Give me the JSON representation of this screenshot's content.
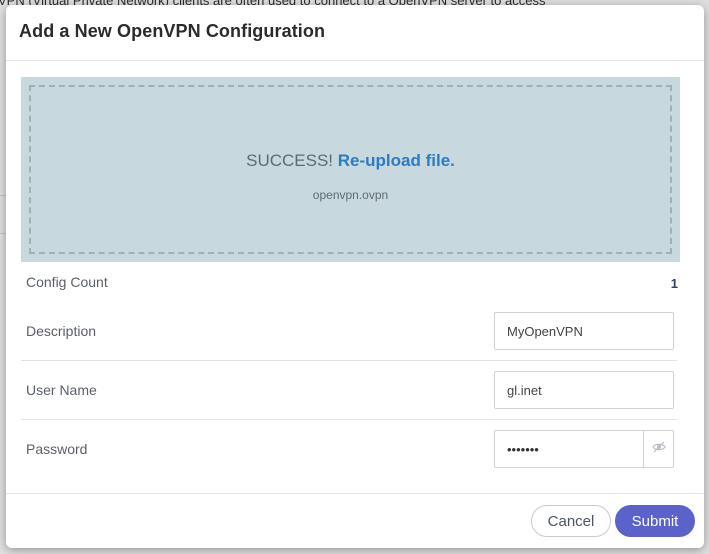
{
  "background": {
    "text": "VPN (Virtual Private Network) clients are often used to connect to a OpenVPN server to access"
  },
  "modal": {
    "title": "Add a New OpenVPN Configuration",
    "upload": {
      "status": "SUCCESS!",
      "reupload_link": "Re-upload file.",
      "filename": "openvpn.ovpn"
    },
    "config_count": {
      "label": "Config Count",
      "value": "1"
    },
    "description": {
      "label": "Description",
      "value": "MyOpenVPN"
    },
    "username": {
      "label": "User Name",
      "value": "gl.inet"
    },
    "password": {
      "label": "Password",
      "value": "•••••••",
      "toggle_icon": "eye-icon"
    },
    "footer": {
      "cancel_label": "Cancel",
      "submit_label": "Submit"
    }
  },
  "colors": {
    "upload_bg": "#c8d8df",
    "link": "#2d7bc0",
    "submit_bg": "#5b62c9",
    "count_value": "#2f4564"
  }
}
